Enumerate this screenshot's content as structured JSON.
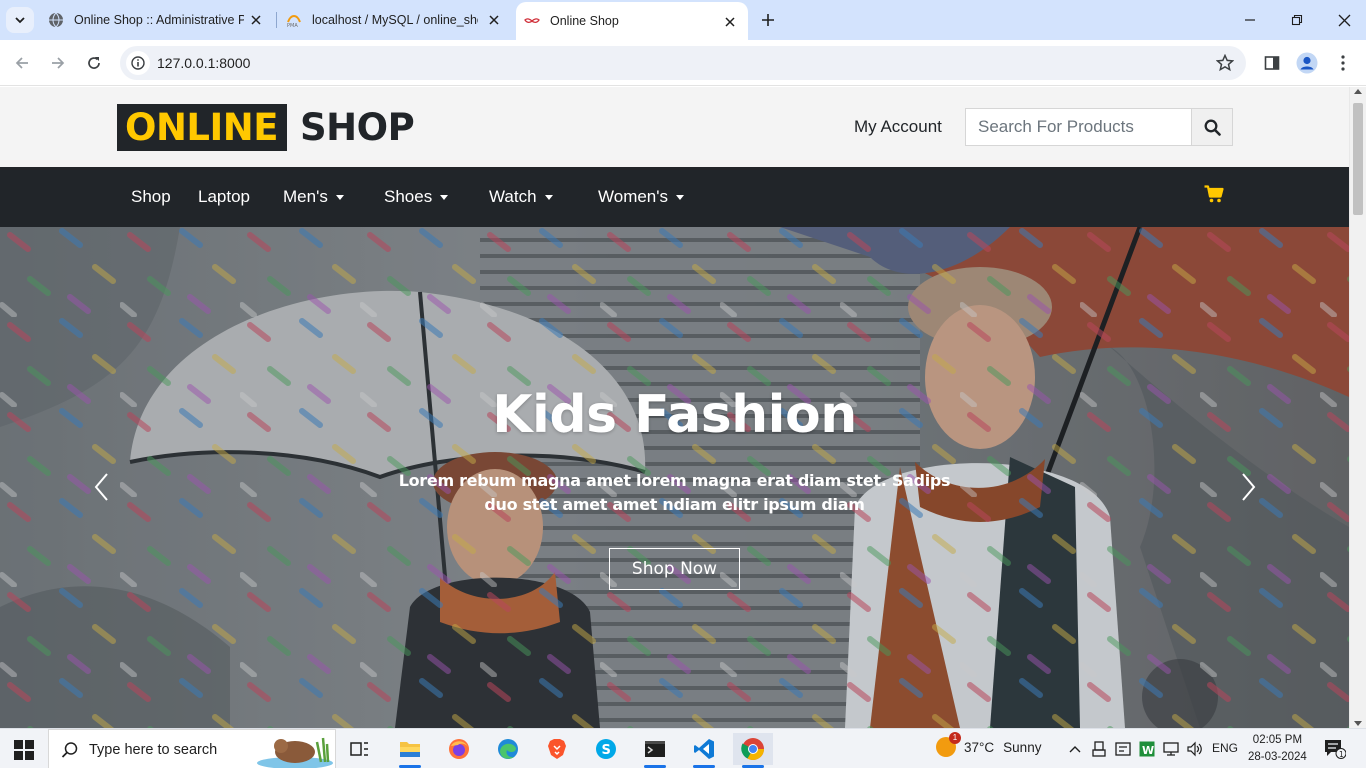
{
  "browser": {
    "tabs": [
      {
        "title": "Online Shop :: Administrative Pa",
        "favicon": "globe-icon"
      },
      {
        "title": "localhost / MySQL / online_shop",
        "favicon": "phpmyadmin-icon"
      },
      {
        "title": "Online Shop",
        "favicon": "mustache-icon",
        "active": true
      }
    ],
    "address": "127.0.0.1:8000"
  },
  "site": {
    "logo_highlight": "ONLINE",
    "logo_rest": "SHOP",
    "my_account": "My Account",
    "search_placeholder": "Search For Products",
    "accent_color": "#ffc800",
    "dark_color": "#212529",
    "nav": [
      {
        "label": "Shop",
        "dropdown": false
      },
      {
        "label": "Laptop",
        "dropdown": false
      },
      {
        "label": "Men's",
        "dropdown": true
      },
      {
        "label": "Shoes",
        "dropdown": true
      },
      {
        "label": "Watch",
        "dropdown": true
      },
      {
        "label": "Women's",
        "dropdown": true
      }
    ],
    "hero": {
      "title": "Kids Fashion",
      "text": "Lorem rebum magna amet lorem magna erat diam stet. Sadips duo stet amet amet ndiam elitr ipsum diam",
      "button": "Shop Now"
    }
  },
  "taskbar": {
    "search_placeholder": "Type here to search",
    "weather_temp": "37°C",
    "weather_cond": "Sunny",
    "weather_badge": "1",
    "language": "ENG",
    "time": "02:05 PM",
    "date": "28-03-2024",
    "notification_count": "1"
  }
}
